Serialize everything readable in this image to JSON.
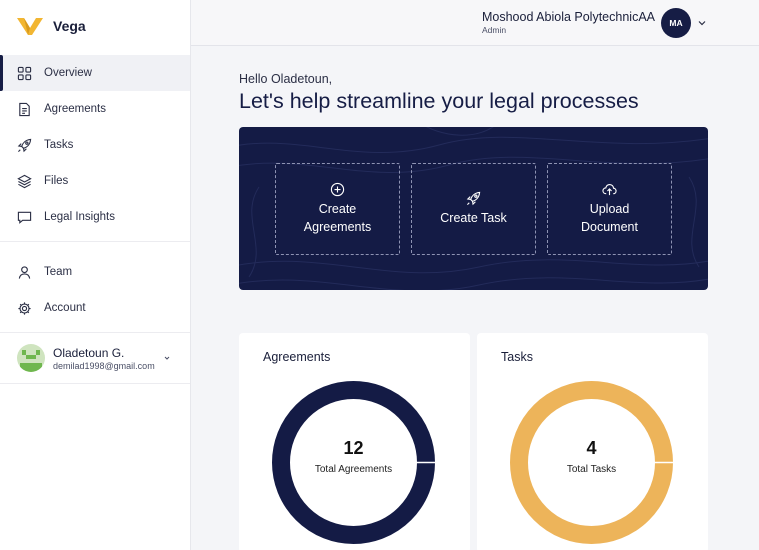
{
  "brand": {
    "name": "Vega",
    "logo_color": "#f2b632"
  },
  "sidebar": {
    "items": [
      {
        "label": "Overview",
        "icon": "grid-icon",
        "active": true
      },
      {
        "label": "Agreements",
        "icon": "document-icon"
      },
      {
        "label": "Tasks",
        "icon": "rocket-icon"
      },
      {
        "label": "Files",
        "icon": "layers-icon"
      },
      {
        "label": "Legal Insights",
        "icon": "chat-icon"
      },
      {
        "label": "Team",
        "icon": "person-icon"
      },
      {
        "label": "Account",
        "icon": "gear-icon"
      }
    ],
    "user": {
      "name": "Oladetoun G.",
      "email": "demilad1998@gmail.com",
      "icon": "chevron-down-icon"
    }
  },
  "header": {
    "org_name": "Moshood Abiola PolytechnicAA",
    "role": "Admin",
    "avatar_initials": "MA"
  },
  "main": {
    "greeting": "Hello Oladetoun,",
    "headline": "Let's help streamline your legal processes",
    "actions": [
      {
        "line1": "Create",
        "line2": "Agreements",
        "icon": "plus-circle-icon"
      },
      {
        "line1": "Create Task",
        "line2": "",
        "icon": "rocket-icon"
      },
      {
        "line1": "Upload",
        "line2": "Document",
        "icon": "cloud-upload-icon"
      }
    ],
    "cards": [
      {
        "title": "Agreements",
        "count": "12",
        "label": "Total Agreements",
        "color": "#141b45"
      },
      {
        "title": "Tasks",
        "count": "4",
        "label": "Total Tasks",
        "color": "#edb45a"
      }
    ]
  },
  "colors": {
    "navy": "#141b45",
    "accent": "#edb45a",
    "background": "#f4f5f8"
  }
}
